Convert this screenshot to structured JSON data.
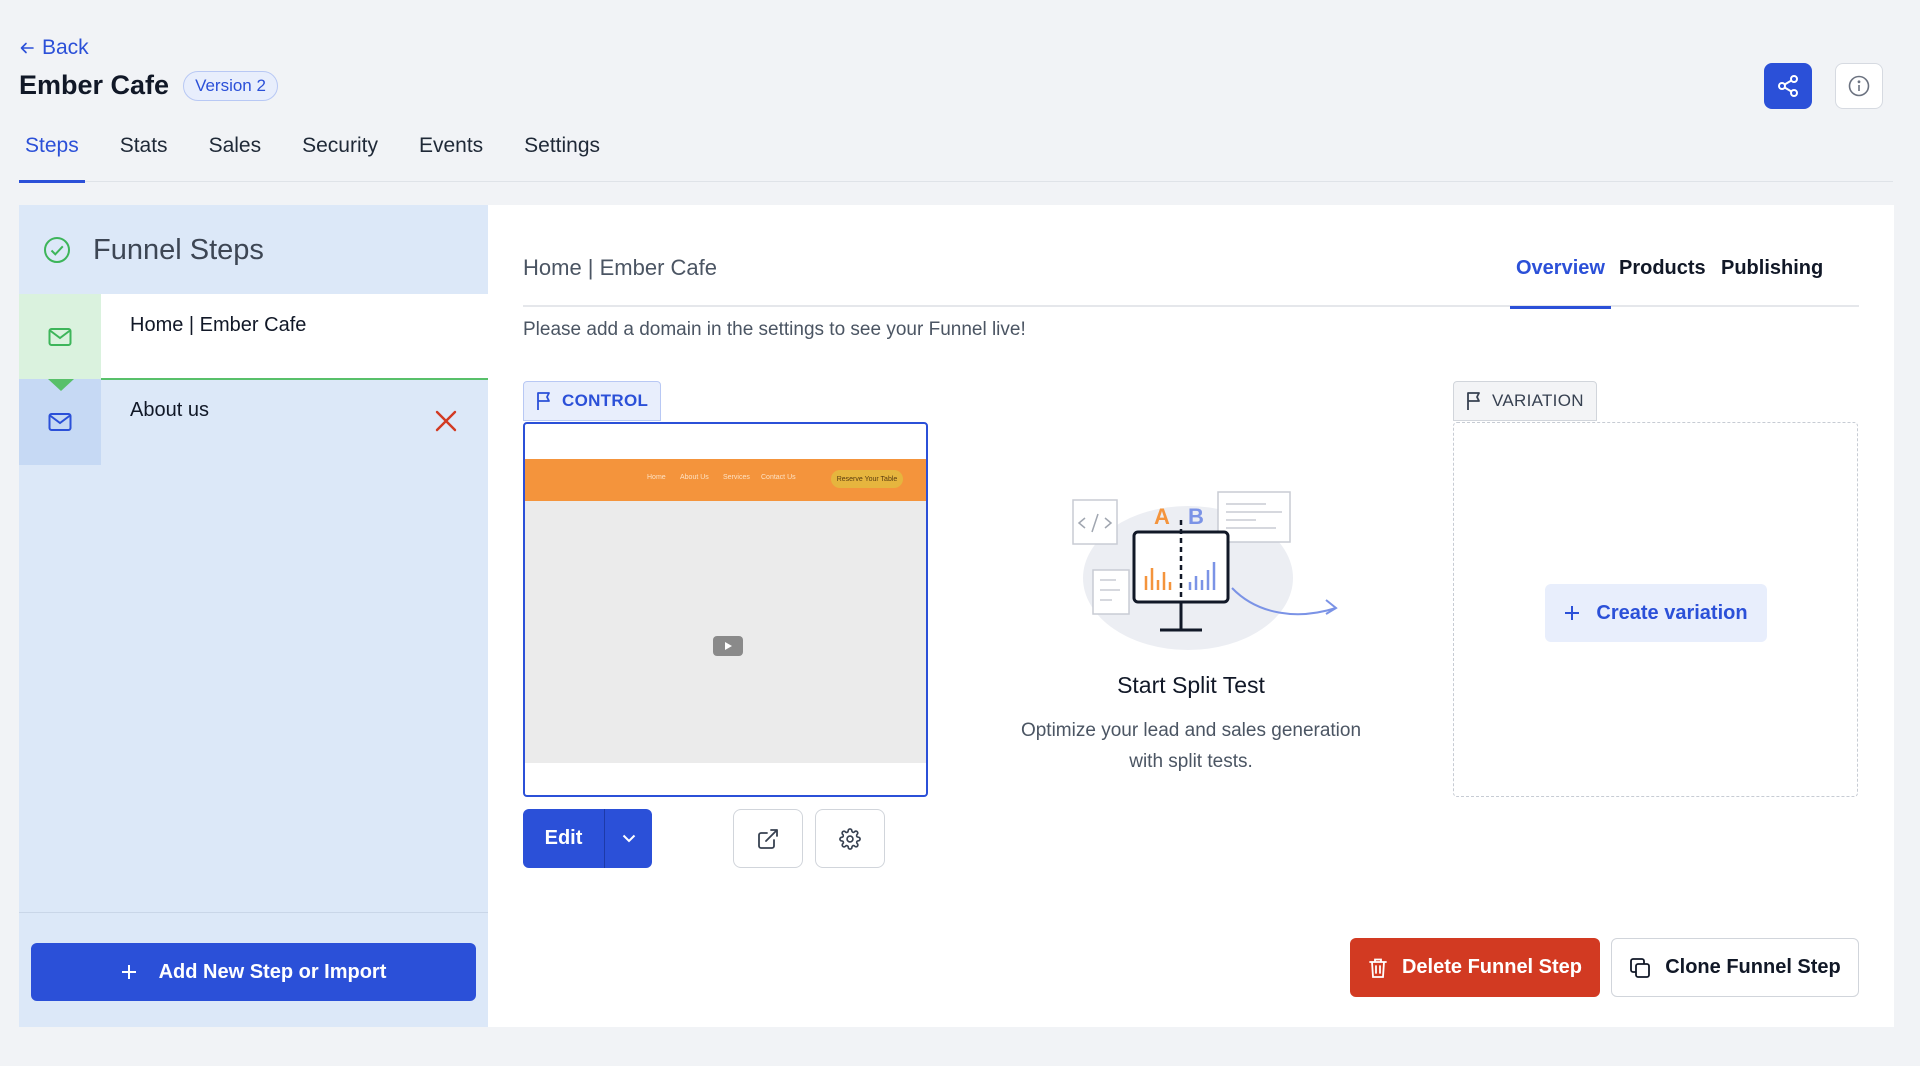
{
  "header": {
    "back_label": "Back",
    "title": "Ember Cafe",
    "version_badge": "Version 2"
  },
  "tabs": [
    {
      "label": "Steps",
      "active": true
    },
    {
      "label": "Stats",
      "active": false
    },
    {
      "label": "Sales",
      "active": false
    },
    {
      "label": "Security",
      "active": false
    },
    {
      "label": "Events",
      "active": false
    },
    {
      "label": "Settings",
      "active": false
    }
  ],
  "sidebar": {
    "title": "Funnel Steps",
    "steps": [
      {
        "label": "Home | Ember Cafe",
        "icon": "mail-icon",
        "selected": true
      },
      {
        "label": "About us",
        "icon": "mail-icon",
        "selected": false
      }
    ],
    "add_button_label": "Add New Step or Import"
  },
  "main": {
    "page_name": "Home | Ember Cafe",
    "subtabs": [
      {
        "label": "Overview",
        "active": true
      },
      {
        "label": "Products",
        "active": false
      },
      {
        "label": "Publishing",
        "active": false
      }
    ],
    "notice": "Please add a domain in the settings to see your Funnel live!",
    "control_tag": "CONTROL",
    "variation_tag": "VARIATION",
    "preview": {
      "nav_links": [
        "Home",
        "About Us",
        "Services",
        "Contact Us"
      ],
      "cta_label": "Reserve Your Table"
    },
    "edit_label": "Edit",
    "split_test": {
      "title": "Start Split Test",
      "description_line1": "Optimize your lead and sales generation",
      "description_line2": "with split tests.",
      "label_a": "A",
      "label_b": "B"
    },
    "create_variation_label": "Create variation",
    "delete_label": "Delete Funnel Step",
    "clone_label": "Clone Funnel Step"
  },
  "colors": {
    "primary": "#2b50d8",
    "danger": "#d23a22",
    "success": "#58c06a",
    "sidebar_bg": "#dce8f8",
    "preview_nav": "#f4943c"
  }
}
